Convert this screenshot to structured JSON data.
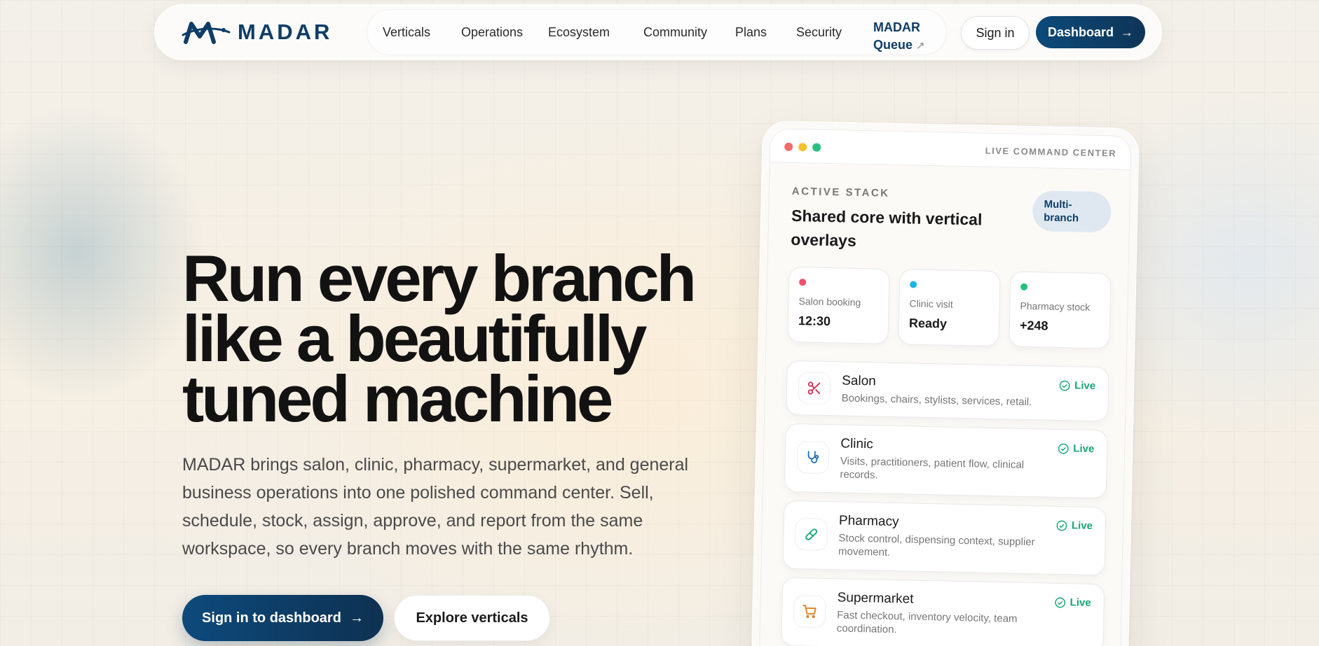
{
  "brand": {
    "name": "MADAR",
    "color": "#0f3d66"
  },
  "nav": {
    "links": [
      "Verticals",
      "Operations",
      "Ecosystem",
      "Community",
      "Plans",
      "Security"
    ],
    "queue_line1": "MADAR",
    "queue_line2": "Queue",
    "queue_icon": "external-link-arrow",
    "signin": "Sign in",
    "dashboard": "Dashboard"
  },
  "hero": {
    "title_line1": "Run every branch",
    "title_line2": "like a beautifully",
    "title_line3": "tuned machine",
    "subtitle": "MADAR brings salon, clinic, pharmacy, supermarket, and general business operations into one polished command center. Sell, schedule, stock, assign, approve, and report from the same workspace, so every branch moves with the same rhythm.",
    "cta_primary": "Sign in to dashboard",
    "cta_secondary": "Explore verticals"
  },
  "device": {
    "topbar_label": "LIVE COMMAND CENTER",
    "eyebrow": "ACTIVE STACK",
    "title": "Shared core with vertical overlays",
    "pill_line1": "Multi-",
    "pill_line2": "branch",
    "stats": [
      {
        "label": "Salon booking",
        "value": "12:30",
        "color": "#f0506e"
      },
      {
        "label": "Clinic visit",
        "value": "Ready",
        "color": "#1bb4e8"
      },
      {
        "label": "Pharmacy stock",
        "value": "+248",
        "color": "#22c07e"
      }
    ],
    "verticals": [
      {
        "name": "Salon",
        "desc": "Bookings, chairs, stylists, services, retail.",
        "status": "Live",
        "icon": "scissors-icon"
      },
      {
        "name": "Clinic",
        "desc": "Visits, practitioners, patient flow, clinical records.",
        "status": "Live",
        "icon": "stethoscope-icon"
      },
      {
        "name": "Pharmacy",
        "desc": "Stock control, dispensing context, supplier movement.",
        "status": "Live",
        "icon": "pill-icon"
      },
      {
        "name": "Supermarket",
        "desc": "Fast checkout, inventory velocity, team coordination.",
        "status": "Live",
        "icon": "cart-icon"
      }
    ],
    "status_color": "#17a673"
  }
}
